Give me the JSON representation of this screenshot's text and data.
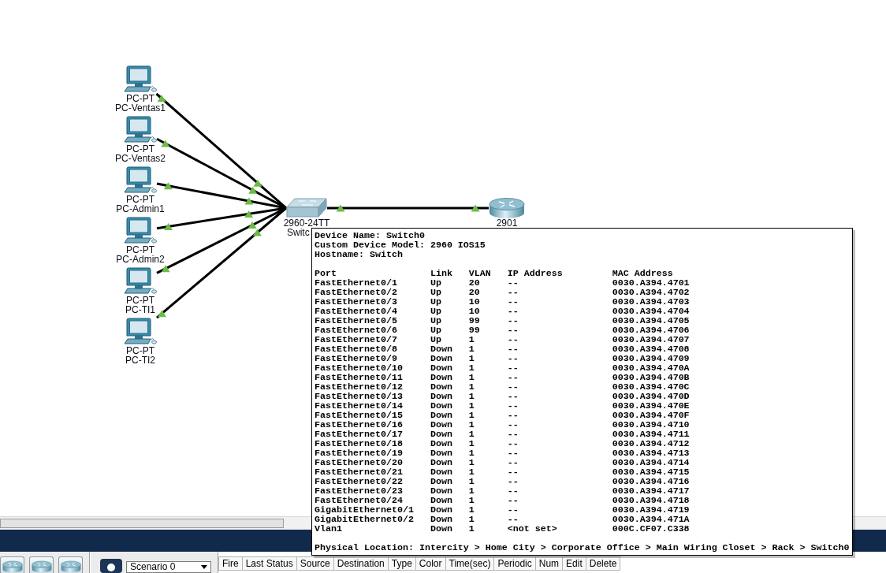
{
  "topology": {
    "pcs": [
      {
        "model": "PC-PT",
        "name": "PC-Ventas1",
        "link_up": true
      },
      {
        "model": "PC-PT",
        "name": "PC-Ventas2",
        "link_up": true
      },
      {
        "model": "PC-PT",
        "name": "PC-Admin1",
        "link_up": true
      },
      {
        "model": "PC-PT",
        "name": "PC-Admin2",
        "link_up": true
      },
      {
        "model": "PC-PT",
        "name": "PC-TI1",
        "link_up": true
      },
      {
        "model": "PC-PT",
        "name": "PC-TI2",
        "link_up": true
      }
    ],
    "switch": {
      "model": "2960-24TT",
      "name": "Switc",
      "uplink_up": true
    },
    "router": {
      "model": "2901"
    }
  },
  "device_tooltip": {
    "info": [
      "Device Name: Switch0",
      "Custom Device Model: 2960 IOS15",
      "Hostname: Switch"
    ],
    "ports_table": {
      "columns": [
        "Port",
        "Link",
        "VLAN",
        "IP Address",
        "MAC Address"
      ],
      "rows": [
        [
          "FastEthernet0/1",
          "Up",
          "20",
          "--",
          "0030.A394.4701"
        ],
        [
          "FastEthernet0/2",
          "Up",
          "20",
          "--",
          "0030.A394.4702"
        ],
        [
          "FastEthernet0/3",
          "Up",
          "10",
          "--",
          "0030.A394.4703"
        ],
        [
          "FastEthernet0/4",
          "Up",
          "10",
          "--",
          "0030.A394.4704"
        ],
        [
          "FastEthernet0/5",
          "Up",
          "99",
          "--",
          "0030.A394.4705"
        ],
        [
          "FastEthernet0/6",
          "Up",
          "99",
          "--",
          "0030.A394.4706"
        ],
        [
          "FastEthernet0/7",
          "Up",
          "1",
          "--",
          "0030.A394.4707"
        ],
        [
          "FastEthernet0/8",
          "Down",
          "1",
          "--",
          "0030.A394.4708"
        ],
        [
          "FastEthernet0/9",
          "Down",
          "1",
          "--",
          "0030.A394.4709"
        ],
        [
          "FastEthernet0/10",
          "Down",
          "1",
          "--",
          "0030.A394.470A"
        ],
        [
          "FastEthernet0/11",
          "Down",
          "1",
          "--",
          "0030.A394.470B"
        ],
        [
          "FastEthernet0/12",
          "Down",
          "1",
          "--",
          "0030.A394.470C"
        ],
        [
          "FastEthernet0/13",
          "Down",
          "1",
          "--",
          "0030.A394.470D"
        ],
        [
          "FastEthernet0/14",
          "Down",
          "1",
          "--",
          "0030.A394.470E"
        ],
        [
          "FastEthernet0/15",
          "Down",
          "1",
          "--",
          "0030.A394.470F"
        ],
        [
          "FastEthernet0/16",
          "Down",
          "1",
          "--",
          "0030.A394.4710"
        ],
        [
          "FastEthernet0/17",
          "Down",
          "1",
          "--",
          "0030.A394.4711"
        ],
        [
          "FastEthernet0/18",
          "Down",
          "1",
          "--",
          "0030.A394.4712"
        ],
        [
          "FastEthernet0/19",
          "Down",
          "1",
          "--",
          "0030.A394.4713"
        ],
        [
          "FastEthernet0/20",
          "Down",
          "1",
          "--",
          "0030.A394.4714"
        ],
        [
          "FastEthernet0/21",
          "Down",
          "1",
          "--",
          "0030.A394.4715"
        ],
        [
          "FastEthernet0/22",
          "Down",
          "1",
          "--",
          "0030.A394.4716"
        ],
        [
          "FastEthernet0/23",
          "Down",
          "1",
          "--",
          "0030.A394.4717"
        ],
        [
          "FastEthernet0/24",
          "Down",
          "1",
          "--",
          "0030.A394.4718"
        ],
        [
          "GigabitEthernet0/1",
          "Down",
          "1",
          "--",
          "0030.A394.4719"
        ],
        [
          "GigabitEthernet0/2",
          "Down",
          "1",
          "--",
          "0030.A394.471A"
        ],
        [
          "Vlan1",
          "Down",
          "1",
          "<not set>",
          "000C.CF07.C338"
        ]
      ]
    },
    "physical_location": "Physical Location: Intercity > Home City > Corporate Office > Main Wiring Closet > Rack > Switch0"
  },
  "bottom_toolbar": {
    "scenario": {
      "value": "Scenario 0"
    },
    "pdu_table": {
      "columns": [
        "Fire",
        "Last Status",
        "Source",
        "Destination",
        "Type",
        "Color",
        "Time(sec)",
        "Periodic",
        "Num",
        "Edit",
        "Delete"
      ]
    }
  }
}
